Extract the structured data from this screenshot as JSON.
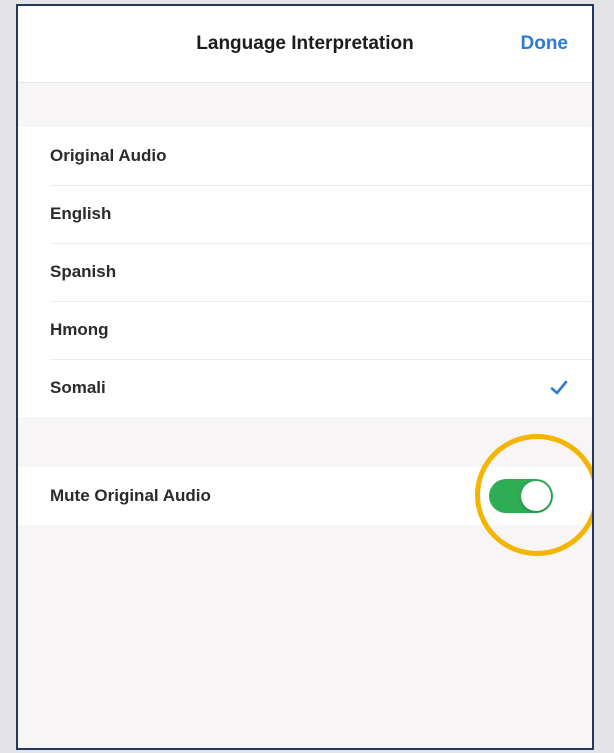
{
  "header": {
    "title": "Language Interpretation",
    "done_label": "Done"
  },
  "languages": [
    {
      "label": "Original Audio",
      "selected": false
    },
    {
      "label": "English",
      "selected": false
    },
    {
      "label": "Spanish",
      "selected": false
    },
    {
      "label": "Hmong",
      "selected": false
    },
    {
      "label": "Somali",
      "selected": true
    }
  ],
  "mute": {
    "label": "Mute Original Audio",
    "enabled": true
  },
  "colors": {
    "accent": "#2f7bd3",
    "toggle_on": "#2ead54",
    "highlight": "#f4b400",
    "frame_border": "#1f3a5c"
  },
  "icons": {
    "selected_marker": "checkmark-icon"
  }
}
